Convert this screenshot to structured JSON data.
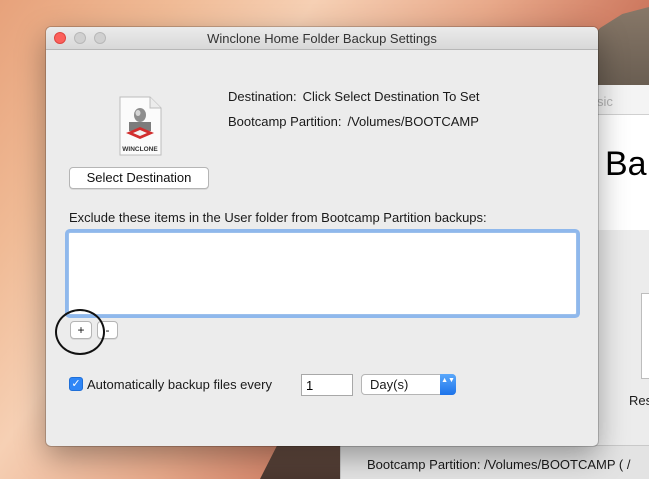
{
  "background_window": {
    "tab_fragment": "sic",
    "title_fragment": "Ba",
    "label_fragment": "Res",
    "status_text": "Bootcamp Partition:  /Volumes/BOOTCAMP ( /"
  },
  "dialog": {
    "title": "Winclone Home Folder Backup Settings",
    "icon_label": "WINCLONE",
    "destination": {
      "label": "Destination:",
      "value": "Click Select Destination To Set"
    },
    "bootcamp": {
      "label": "Bootcamp Partition:",
      "value": "/Volumes/BOOTCAMP"
    },
    "select_destination_button": "Select Destination",
    "exclude_label": "Exclude these items in the User folder from Bootcamp Partition backups:",
    "exclude_items": [],
    "add_button": "+",
    "remove_button": "-",
    "auto_backup": {
      "checked": true,
      "checkmark": "✓",
      "label": "Automatically backup files every",
      "interval": "1",
      "unit": "Day(s)",
      "unit_arrows": "▲▼"
    }
  },
  "colors": {
    "accent": "#2f86f6",
    "close_button": "#fc605b",
    "list_focus_ring": "#8fb8ec"
  }
}
